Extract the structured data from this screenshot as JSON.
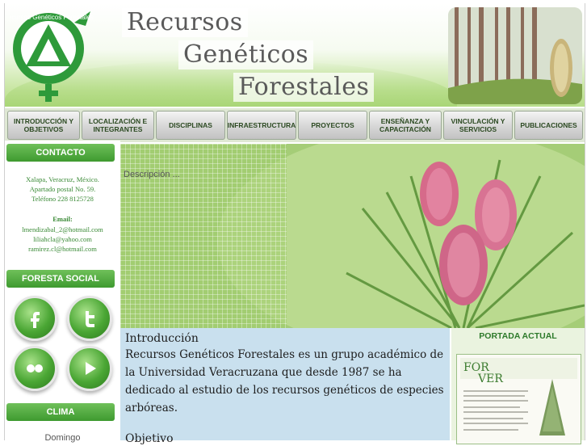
{
  "header": {
    "logo_text": "Recursos Genéticos Forestales",
    "title_line1": "Recursos",
    "title_line2": "Genéticos",
    "title_line3": "Forestales"
  },
  "nav": {
    "items": [
      {
        "label": "INTRODUCCIÓN Y OBJETIVOS"
      },
      {
        "label": "LOCALIZACIÓN E INTEGRANTES"
      },
      {
        "label": "DISCIPLINAS"
      },
      {
        "label": "INFRAESTRUCTURA"
      },
      {
        "label": "PROYECTOS"
      },
      {
        "label": "ENSEÑANZA Y CAPACITACIÓN"
      },
      {
        "label": "VINCULACIÓN Y SERVICIOS"
      },
      {
        "label": "PUBLICACIONES"
      }
    ]
  },
  "sidebar": {
    "contact_heading": "CONTACTO",
    "address_line1": "Xalapa, Veracruz, México.",
    "address_line2": "Apartado postal No. 59.",
    "address_line3": "Teléfono 228 8125728",
    "email_label": "Email:",
    "email1": "lmendizabal_2@hotmail.com",
    "email2": "liliahcla@yahoo.com",
    "email3": "ramirez.cl@hotmail.com",
    "social_heading": "FORESTA SOCIAL",
    "social_icons": [
      "facebook-icon",
      "twitter-icon",
      "flickr-icon",
      "play-icon"
    ],
    "weather_heading": "CLIMA",
    "weather_day": "Domingo"
  },
  "hero": {
    "description": "Descripción ..."
  },
  "intro": {
    "heading": "Introducción",
    "body": "Recursos Genéticos Forestales es un grupo académico de la Universidad Veracruzana que desde 1987 se ha dedicado al estudio de los recursos genéticos de especies arbóreas.",
    "objective_heading": "Objetivo"
  },
  "portada": {
    "heading": "PORTADA ACTUAL",
    "cover_title_1": "FOR",
    "cover_title_2": "VER"
  },
  "colors": {
    "accent_green": "#3e9a2f",
    "nav_text": "#2c4a22",
    "intro_bg": "#c9e0ee"
  }
}
